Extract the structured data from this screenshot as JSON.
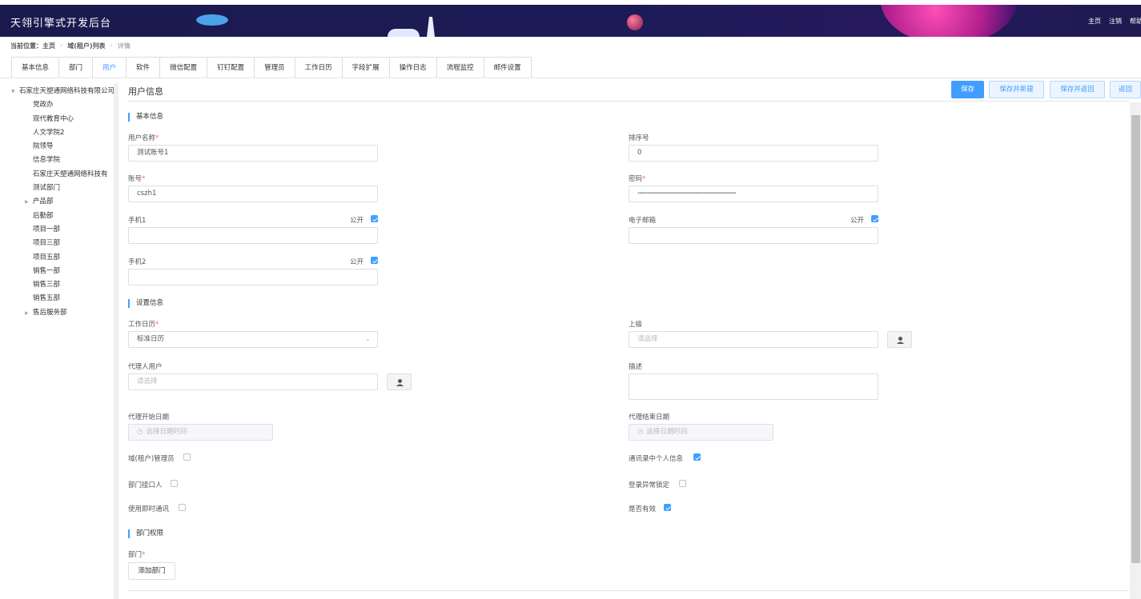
{
  "header": {
    "title": "天翎引擎式开发后台",
    "links": [
      "主页",
      "注销",
      "帮助"
    ]
  },
  "breadcrumb": {
    "label": "当前位置：",
    "items": [
      "主页",
      "域(租户)列表",
      "详情"
    ]
  },
  "tabs": [
    "基本信息",
    "部门",
    "用户",
    "软件",
    "微信配置",
    "钉钉配置",
    "管理员",
    "工作日历",
    "字段扩展",
    "操作日志",
    "流程监控",
    "邮件设置"
  ],
  "active_tab": "用户",
  "tree": {
    "root": "石家庄天塑通网络科技有限公司",
    "items": [
      {
        "label": "党政办",
        "expandable": false
      },
      {
        "label": "现代教育中心",
        "expandable": false
      },
      {
        "label": "人文学院2",
        "expandable": false
      },
      {
        "label": "院领导",
        "expandable": false
      },
      {
        "label": "信息学院",
        "expandable": false
      },
      {
        "label": "石家庄天塑通网络科技有",
        "expandable": false
      },
      {
        "label": "测试部门",
        "expandable": false
      },
      {
        "label": "产品部",
        "expandable": true
      },
      {
        "label": "后勤部",
        "expandable": false
      },
      {
        "label": "项目一部",
        "expandable": false
      },
      {
        "label": "项目三部",
        "expandable": false
      },
      {
        "label": "项目五部",
        "expandable": false
      },
      {
        "label": "销售一部",
        "expandable": false
      },
      {
        "label": "销售三部",
        "expandable": false
      },
      {
        "label": "销售五部",
        "expandable": false
      },
      {
        "label": "售后服务部",
        "expandable": true
      }
    ]
  },
  "main": {
    "title": "用户信息"
  },
  "buttons": {
    "save": "保存",
    "save_new": "保存并新建",
    "save_back": "保存并返回",
    "back": "返回"
  },
  "sections": {
    "basic": "基本信息",
    "settings": "设置信息",
    "dept_perm": "部门权限"
  },
  "form": {
    "username": {
      "label": "用户名称",
      "value": "测试账号1"
    },
    "sort": {
      "label": "排序号",
      "value": "0"
    },
    "account": {
      "label": "账号",
      "value": "cszh1"
    },
    "password": {
      "label": "密码",
      "value": "•••••••••••••••••••••••••••••••••••••••••••••••••••••••••••••••"
    },
    "mobile1": {
      "label": "手机1",
      "public_label": "公开",
      "public": true,
      "value": ""
    },
    "email": {
      "label": "电子邮箱",
      "public_label": "公开",
      "public": true,
      "value": ""
    },
    "mobile2": {
      "label": "手机2",
      "public_label": "公开",
      "public": true,
      "value": ""
    },
    "calendar": {
      "label": "工作日历",
      "value": "标准日历"
    },
    "superior": {
      "label": "上级",
      "placeholder": "请选择"
    },
    "proxy_user": {
      "label": "代理人用户",
      "placeholder": "请选择"
    },
    "description": {
      "label": "描述",
      "value": ""
    },
    "proxy_start": {
      "label": "代理开始日期",
      "placeholder": "选择日期时间"
    },
    "proxy_end": {
      "label": "代理结束日期",
      "placeholder": "选择日期时间"
    },
    "domain_admin": {
      "label": "域(租户)管理员",
      "checked": false
    },
    "contacts_info": {
      "label": "通讯录中个人信息",
      "checked": true
    },
    "dept_interface": {
      "label": "部门接口人",
      "checked": false
    },
    "login_lock": {
      "label": "登录异常锁定",
      "checked": false
    },
    "instant_msg": {
      "label": "使用即时通讯",
      "checked": false
    },
    "valid": {
      "label": "是否有效",
      "checked": true
    },
    "department": {
      "label": "部门",
      "add_button": "添加部门"
    }
  },
  "colors": {
    "primary": "#409eff",
    "header_bg": "#1c1b57",
    "required": "#f56c6c"
  }
}
